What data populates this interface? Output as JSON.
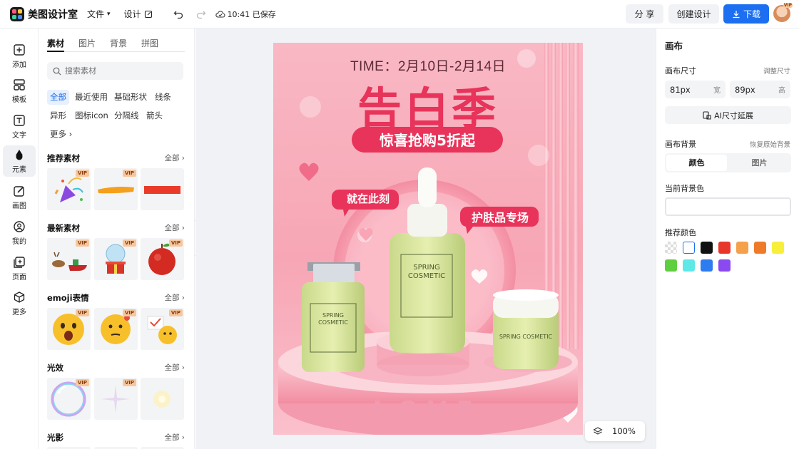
{
  "app": {
    "title": "美图设计室"
  },
  "topbar": {
    "menu_file": "文件",
    "menu_design": "设计",
    "save_status": "10:41 已保存",
    "share_label": "分 享",
    "create_label": "创建设计",
    "download_label": "下载",
    "avatar_badge": "VIP"
  },
  "iconbar": {
    "items": [
      {
        "label": "添加",
        "icon": "plus-square-icon"
      },
      {
        "label": "模板",
        "icon": "template-icon"
      },
      {
        "label": "文字",
        "icon": "text-icon"
      },
      {
        "label": "元素",
        "icon": "shapes-icon"
      },
      {
        "label": "画图",
        "icon": "draw-icon"
      },
      {
        "label": "我的",
        "icon": "user-icon"
      },
      {
        "label": "页面",
        "icon": "page-add-icon"
      },
      {
        "label": "更多",
        "icon": "cube-icon"
      }
    ]
  },
  "panel": {
    "tabs": [
      "素材",
      "图片",
      "背景",
      "拼图"
    ],
    "search_placeholder": "搜索素材",
    "chips": [
      "全部",
      "最近使用",
      "基础形状",
      "线条",
      "异形",
      "图标icon",
      "分隔线",
      "箭头",
      "更多"
    ],
    "all_label": "全部",
    "vip_label": "VIP",
    "sections": [
      {
        "title": "推荐素材"
      },
      {
        "title": "最新素材"
      },
      {
        "title": "emoji表情"
      },
      {
        "title": "光效"
      },
      {
        "title": "光影"
      }
    ]
  },
  "poster": {
    "time_text": "TIME：2月10日-2月14日",
    "headline": "告白季",
    "subline": "惊喜抢购5折起",
    "bubble_left": "就在此刻",
    "bubble_right": "护肤品专场",
    "bottle_brand_1": "SPRING",
    "bottle_brand_2": "COSMETIC",
    "jar_brand": "SPRING COSMETIC",
    "stage_text": "LOVE"
  },
  "zoom": {
    "value": "100%"
  },
  "rpanel": {
    "title": "画布",
    "size_label": "画布尺寸",
    "adjust_link": "调整尺寸",
    "width_value": "81px",
    "width_unit": "宽",
    "height_value": "89px",
    "height_unit": "高",
    "ai_extend": "AI尺寸延展",
    "bg_label": "画布背景",
    "restore_link": "恢复原始背景",
    "bg_tabs": [
      "颜色",
      "图片"
    ],
    "current_bg_label": "当前背景色",
    "recommended_label": "推荐颜色",
    "swatches": [
      "transparent",
      "#ffffff",
      "#111111",
      "#e8372a",
      "#f5a04a",
      "#ef7b2a",
      "#f7ef3a",
      "#5fcf3f",
      "#5fe8e8",
      "#2d7df0",
      "#8b4af0"
    ]
  }
}
